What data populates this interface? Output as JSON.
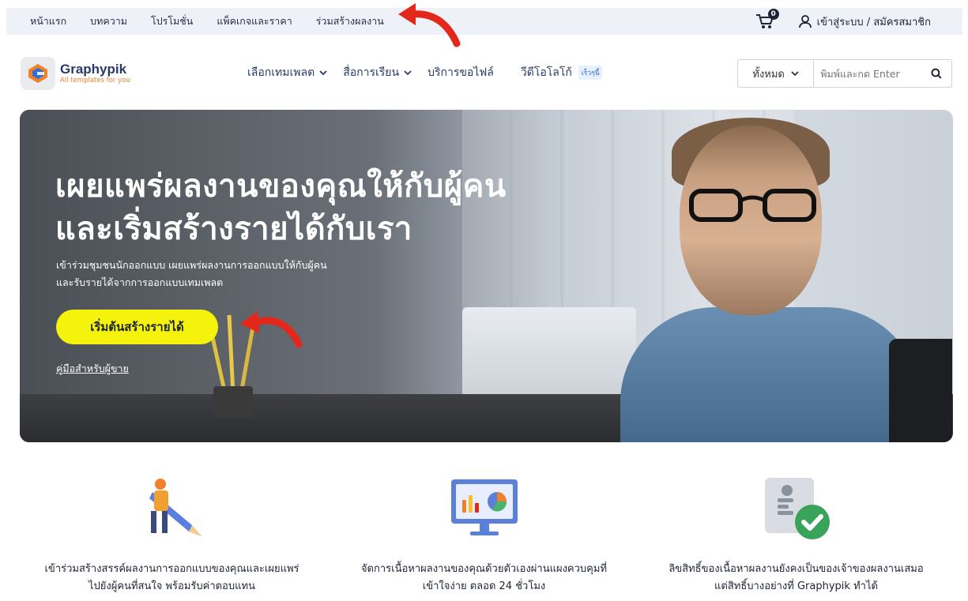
{
  "topbar": {
    "nav": [
      "หน้าแรก",
      "บทความ",
      "โปรโมชั่น",
      "แพ็คเกจและราคา",
      "ร่วมสร้างผลงาน"
    ],
    "cart_count": "0",
    "login_label": "เข้าสู่ระบบ / สมัครสมาชิก"
  },
  "header": {
    "brand": "Graphypik",
    "tagline": "All templates for you",
    "nav": [
      {
        "label": "เลือกเทมเพลต",
        "dropdown": true
      },
      {
        "label": "สื่อการเรียน",
        "dropdown": true
      },
      {
        "label": "บริการขอไฟล์",
        "dropdown": false
      },
      {
        "label": "วีดีโอโลโก้",
        "dropdown": false,
        "badge": "เร็วๆนี้"
      }
    ],
    "search": {
      "category": "ทั้งหมด",
      "placeholder": "พิมพ์และกด Enter"
    }
  },
  "hero": {
    "title_line1": "เผยแพร่ผลงานของคุณให้กับผู้คน",
    "title_line2": "และเริ่มสร้างรายได้กับเรา",
    "sub_line1": "เข้าร่วมชุมชนนักออกแบบ เผยแพร่ผลงานการออกแบบให้กับผู้คน",
    "sub_line2": "และรับรายได้จากการออกแบบเทมเพลต",
    "cta_label": "เริ่มต้นสร้างรายได้",
    "guide_label": "คู่มือสำหรับผู้ขาย"
  },
  "features": [
    {
      "icon": "designer-pencil-icon",
      "line1": "เข้าร่วมสร้างสรรค์ผลงานการออกแบบของคุณและเผยแพร่",
      "line2": "ไปยังผู้คนที่สนใจ พร้อมรับค่าตอบแทน"
    },
    {
      "icon": "dashboard-monitor-icon",
      "line1": "จัดการเนื้อหาผลงานของคุณด้วยตัวเองผ่านแผงควบคุมที่",
      "line2": "เข้าใจง่าย ตลอด 24 ชั่วโมง"
    },
    {
      "icon": "verified-owner-icon",
      "line1": "ลิขสิทธิ์ของเนื้อหาผลงานยังคงเป็นของเจ้าของผลงานเสมอ",
      "line2": "แต่สิทธิ์บางอย่างที่ Graphypik ทำได้"
    }
  ],
  "colors": {
    "accent_yellow": "#f5f20c",
    "annotation_red": "#e3271b",
    "brand_navy": "#2a3a66"
  }
}
